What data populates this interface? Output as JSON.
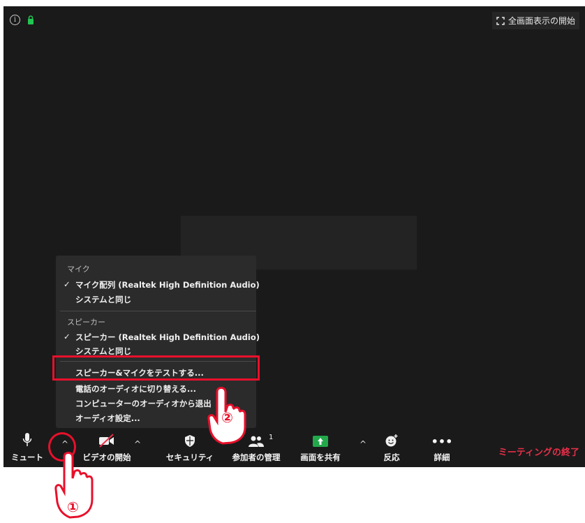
{
  "top": {
    "fullscreen_label": "全画面表示の開始"
  },
  "menu": {
    "mic_header": "マイク",
    "mic_item_1": "マイク配列 (Realtek High Definition Audio)",
    "mic_item_2": "システムと同じ",
    "speaker_header": "スピーカー",
    "speaker_item_1": "スピーカー (Realtek High Definition Audio)",
    "speaker_item_2": "システムと同じ",
    "action_1": "スピーカー&マイクをテストする...",
    "action_2": "電話のオーディオに切り替える...",
    "action_3": "コンピューターのオーディオから退出",
    "action_4": "オーディオ設定...",
    "check": "✓"
  },
  "toolbar": {
    "mute": "ミュート",
    "video": "ビデオの開始",
    "security": "セキュリティ",
    "participants": "参加者の管理",
    "participants_count": "1",
    "share": "画面を共有",
    "reactions": "反応",
    "more": "詳細",
    "end": "ミーティングの終了",
    "caret": "^"
  },
  "annotations": {
    "step1": "①",
    "step2": "②"
  },
  "colors": {
    "highlight": "#e8102b",
    "share_green": "#23a84b",
    "end_red": "#e8304a",
    "lock_green": "#23c552"
  }
}
